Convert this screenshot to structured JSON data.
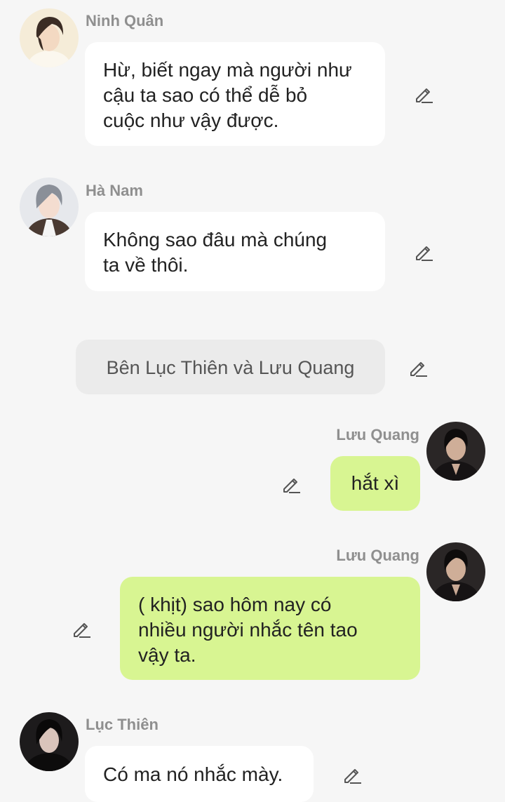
{
  "messages": [
    {
      "type": "incoming",
      "sender": "Ninh Quân",
      "avatar_icon": "avatar-ninh-quan",
      "lines": [
        "Hừ, biết ngay mà người như",
        "cậu ta sao có thể dễ bỏ",
        "cuộc như vậy được."
      ]
    },
    {
      "type": "incoming",
      "sender": "Hà Nam",
      "avatar_icon": "avatar-ha-nam",
      "lines": [
        "Không sao đâu mà chúng",
        "ta về thôi."
      ]
    },
    {
      "type": "narration",
      "lines": [
        "Bên Lục Thiên và Lưu Quang"
      ]
    },
    {
      "type": "outgoing",
      "sender": "Lưu Quang",
      "avatar_icon": "avatar-luu-quang",
      "lines": [
        "hắt xì"
      ]
    },
    {
      "type": "outgoing",
      "sender": "Lưu Quang",
      "avatar_icon": "avatar-luu-quang",
      "lines": [
        "( khịt) sao hôm nay có",
        "nhiều người nhắc tên tao",
        "vậy ta."
      ]
    },
    {
      "type": "incoming",
      "sender": "Lục Thiên",
      "avatar_icon": "avatar-luc-thien",
      "lines": [
        "Có ma nó nhắc mày."
      ]
    }
  ],
  "colors": {
    "background": "#f6f6f6",
    "incoming_bubble": "#ffffff",
    "outgoing_bubble": "#d8f592",
    "narration_bubble": "#ebebeb",
    "sender_name": "#8f8f8f",
    "edit_icon": "#555555"
  },
  "icons": {
    "edit": "pencil-edit-icon"
  }
}
